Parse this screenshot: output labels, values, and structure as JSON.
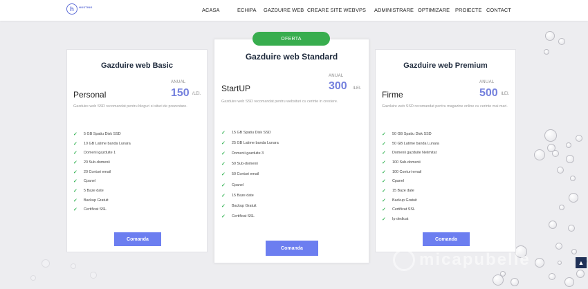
{
  "brand": {
    "logo_letter": "h",
    "logo_text": "HOSTING"
  },
  "nav": {
    "items": [
      "ACASA",
      "ECHIPA",
      "GAZDUIRE WEB",
      "CREARE SITE WEB",
      "VPS",
      "ADMINISTRARE",
      "OPTIMIZARE",
      "PROIECTE",
      "CONTACT"
    ]
  },
  "badge": "OFERTA",
  "cards": [
    {
      "title": "Gazduire web Basic",
      "plan": "Personal",
      "period": "ANUAL",
      "price": "150",
      "unit": "/LEI.",
      "description": "Gazduire web SSD recomandat pentru bloguri si situri de prezentare.",
      "features": [
        "5 GB Spatiu Disk SSD",
        "10 GB Latime banda Lunara",
        "Domenii gazduite 1",
        "20 Sub-domenii",
        "20 Conturi email",
        "Cpanel",
        "5 Baze date",
        "Backup Gratuit",
        "Certificat SSL"
      ],
      "button": "Comanda"
    },
    {
      "title": "Gazduire web Standard",
      "plan": "StartUP",
      "period": "ANUAL",
      "price": "300",
      "unit": "/LEI.",
      "description": "Gazduire web SSD recomandat pentru websituri cu cerinte in crestere.",
      "features": [
        "15 GB Spatiu Disk SSD",
        "25 GB Latime banda Lunara",
        "Domenii gazduite 3",
        "50 Sub-domenii",
        "50 Conturi email",
        "Cpanel",
        "15 Baze date",
        "Backup Gratuit",
        "Certificat SSL"
      ],
      "button": "Comanda"
    },
    {
      "title": "Gazduire web Premium",
      "plan": "Firme",
      "period": "ANUAL",
      "price": "500",
      "unit": "/LEI.",
      "description": "Gazduire web SSD recomandat pentru magazine online cu cerinte mai mari.",
      "features": [
        "50 GB Spatiu Disk SSD",
        "50 GB Latime banda Lunara",
        "Domenii gazduite Nelimitat",
        "100 Sub-domenii",
        "100 Conturi email",
        "Cpanel",
        "15 Baze date",
        "Backup Gratuit",
        "Certificat SSL",
        "Ip dedicat"
      ],
      "button": "Comanda"
    }
  ],
  "watermark": "micapubelle",
  "icons": {
    "check": "check-icon",
    "scroll_top": "chevron-up-icon",
    "logo": "logo-icon"
  },
  "colors": {
    "accent": "#7480dd",
    "button": "#6c7ef0",
    "badge": "#38ad4e",
    "check": "#3cb65a",
    "nav_bg": "#ffffff",
    "page_bg": "#ededf0"
  }
}
